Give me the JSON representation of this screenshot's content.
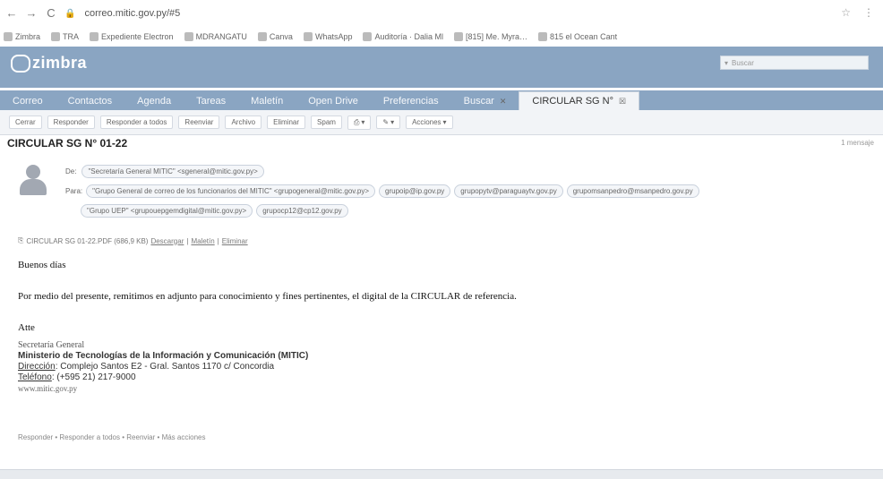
{
  "browser": {
    "url": "correo.mitic.gov.py/#5",
    "bookmarks": [
      "Zimbra",
      "TRA",
      "Expediente Electron",
      "MDRANGATU",
      "Canva",
      "WhatsApp",
      "Auditoría · Dalia Ml",
      "[815] Me. Myra…",
      "815 el Ocean Cant"
    ]
  },
  "app": {
    "name": "zimbra",
    "search_placeholder": "Buscar"
  },
  "tabs": [
    {
      "label": "Correo"
    },
    {
      "label": "Contactos"
    },
    {
      "label": "Agenda"
    },
    {
      "label": "Tareas"
    },
    {
      "label": "Maletín"
    },
    {
      "label": "Open Drive"
    },
    {
      "label": "Preferencias"
    },
    {
      "label": "Buscar"
    },
    {
      "label": "CIRCULAR SG N°"
    }
  ],
  "toolbar": {
    "buttons": [
      {
        "label": "Cerrar"
      },
      {
        "label": "Responder"
      },
      {
        "label": "Responder a todos"
      },
      {
        "label": "Reenviar"
      },
      {
        "label": "Archivo"
      },
      {
        "label": "Eliminar"
      },
      {
        "label": "Spam"
      },
      {
        "label": "Acciones"
      }
    ]
  },
  "message": {
    "subject": "CIRCULAR SG N° 01-22",
    "count": "1 mensaje",
    "de_label": "De:",
    "from": "\"Secretaría General MITIC\" <sgeneral@mitic.gov.py>",
    "para_label": "Para:",
    "to": [
      "\"Grupo General de correo de los funcionarios del MITIC\" <grupogeneral@mitic.gov.py>",
      "grupoip@ip.gov.py",
      "grupopytv@paraguaytv.gov.py",
      "grupomsanpedro@msanpedro.gov.py",
      "\"Grupo UEP\" <grupouepgemdigital@mitic.gov.py>",
      "grupocp12@cp12.gov.py"
    ],
    "attachment": {
      "name": "CIRCULAR SG 01-22.PDF (686,9 KB)",
      "download": "Descargar",
      "briefcase": "Maletín",
      "delete": "Eliminar"
    },
    "greeting": "Buenos días",
    "body": "Por medio del presente, remitimos en adjunto para conocimiento y fines pertinentes, el digital de la CIRCULAR de referencia.",
    "closing": "Atte",
    "signature": {
      "line1": "Secretaría General",
      "line2": "Ministerio de Tecnologías de la Información y Comunicación (MITIC)",
      "address_label": "Dirección",
      "address": "Complejo Santos E2 - Gral. Santos 1170 c/ Concordia",
      "phone_label": "Teléfono",
      "phone": "(+595 21) 217-9000",
      "web": "www.mitic.gov.py"
    }
  },
  "footer": {
    "links": [
      "Responder",
      "Responder a todos",
      "Reenviar",
      "Más acciones"
    ]
  }
}
